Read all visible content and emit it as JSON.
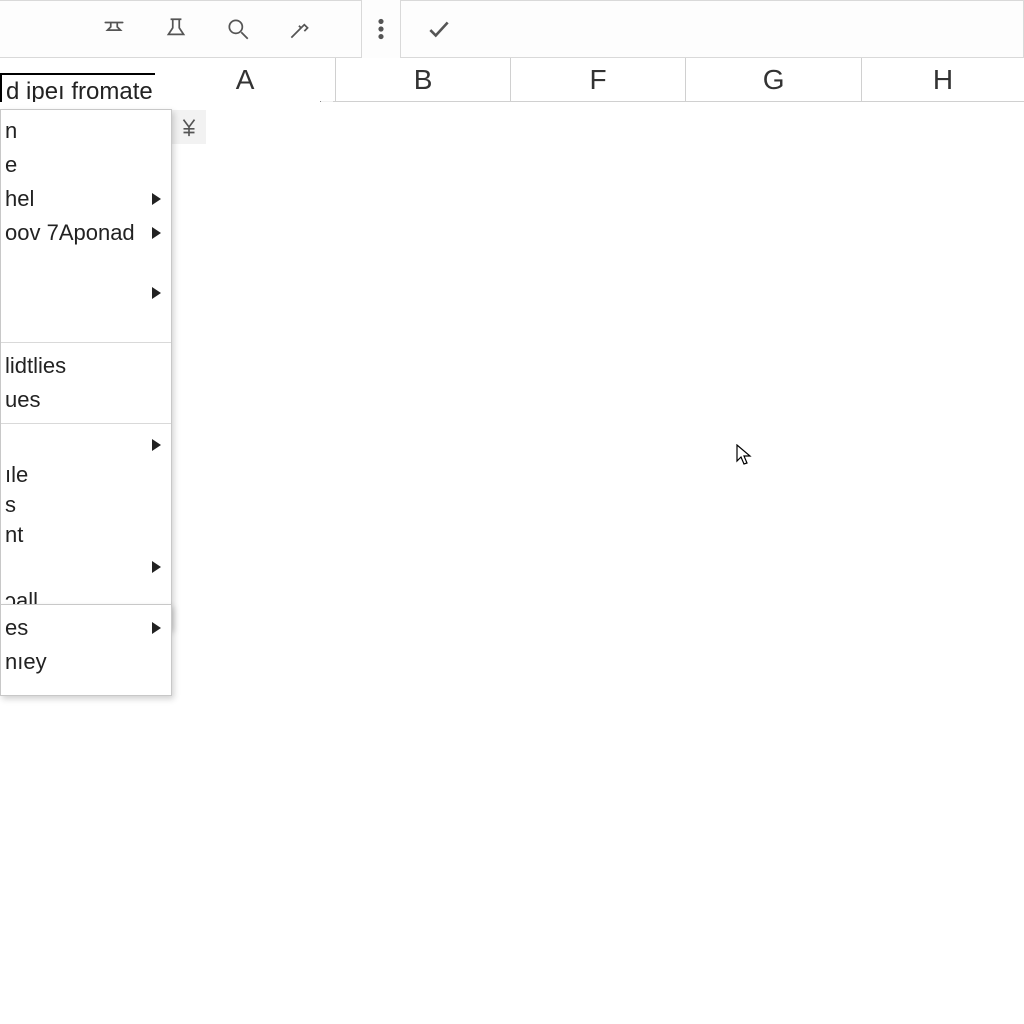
{
  "name_box": {
    "value": "d ipeı fromate"
  },
  "columns": [
    "A",
    "B",
    "F",
    "G",
    "H"
  ],
  "menu1": {
    "items": [
      {
        "label": "n",
        "submenu": false
      },
      {
        "label": "e",
        "submenu": false
      },
      {
        "label": "hel",
        "submenu": true
      },
      {
        "label": "oov 7Aponad",
        "submenu": true
      },
      {
        "label": "",
        "submenu": true,
        "gapBefore": true
      },
      {
        "label": "lidtlies",
        "submenu": false,
        "sepBefore": true,
        "gapBefore": true
      },
      {
        "label": "ues",
        "submenu": false
      },
      {
        "label": "",
        "submenu": true,
        "sepBefore": true
      },
      {
        "label": "ıle",
        "submenu": false
      },
      {
        "label": "s",
        "submenu": false
      },
      {
        "label": "nt",
        "submenu": false
      },
      {
        "label": "",
        "submenu": true,
        "gapSmall": true
      },
      {
        "label": "ɔall",
        "submenu": false
      }
    ]
  },
  "menu2": {
    "items": [
      {
        "label": "es",
        "submenu": true
      },
      {
        "label": "nıey",
        "submenu": false
      }
    ]
  }
}
